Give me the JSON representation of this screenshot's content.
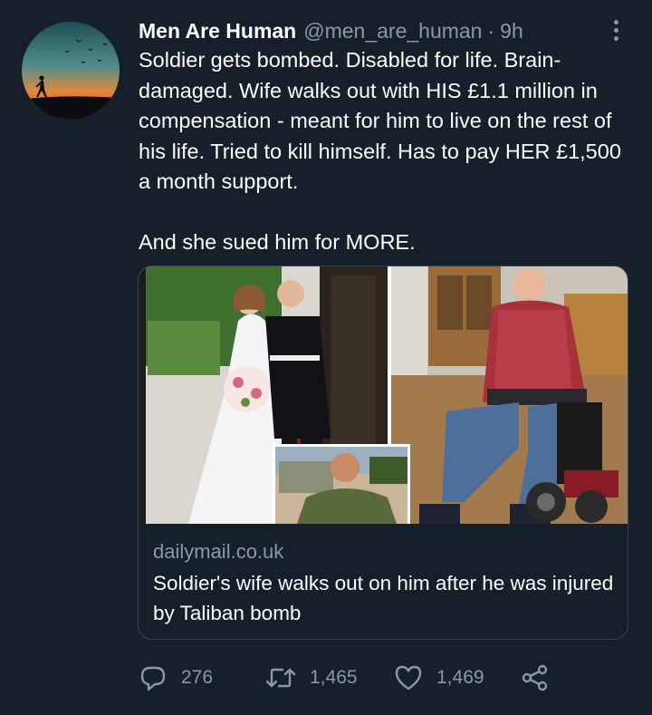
{
  "tweet": {
    "display_name": "Men Are Human",
    "handle": "@men_are_human",
    "separator": "·",
    "time": "9h",
    "text_paragraph_1": "Soldier gets bombed. Disabled for life. Brain-damaged.  Wife walks out with HIS £1.1 million in compensation - meant for him to live on the rest of his life. Tried to kill himself. Has to pay HER £1,500 a month support.",
    "text_paragraph_2": "And she sued him for MORE."
  },
  "card": {
    "domain": "dailymail.co.uk",
    "title": "Soldier's wife walks out on him after he was injured by Taliban bomb"
  },
  "actions": {
    "replies": "276",
    "retweets": "1,465",
    "likes": "1,469"
  },
  "icons": {
    "reply": "reply-icon",
    "retweet": "retweet-icon",
    "like": "heart-icon",
    "share": "share-icon",
    "more": "more-icon"
  },
  "colors": {
    "background": "#15202b",
    "secondary_text": "#8b98a5",
    "border": "#38444d"
  }
}
